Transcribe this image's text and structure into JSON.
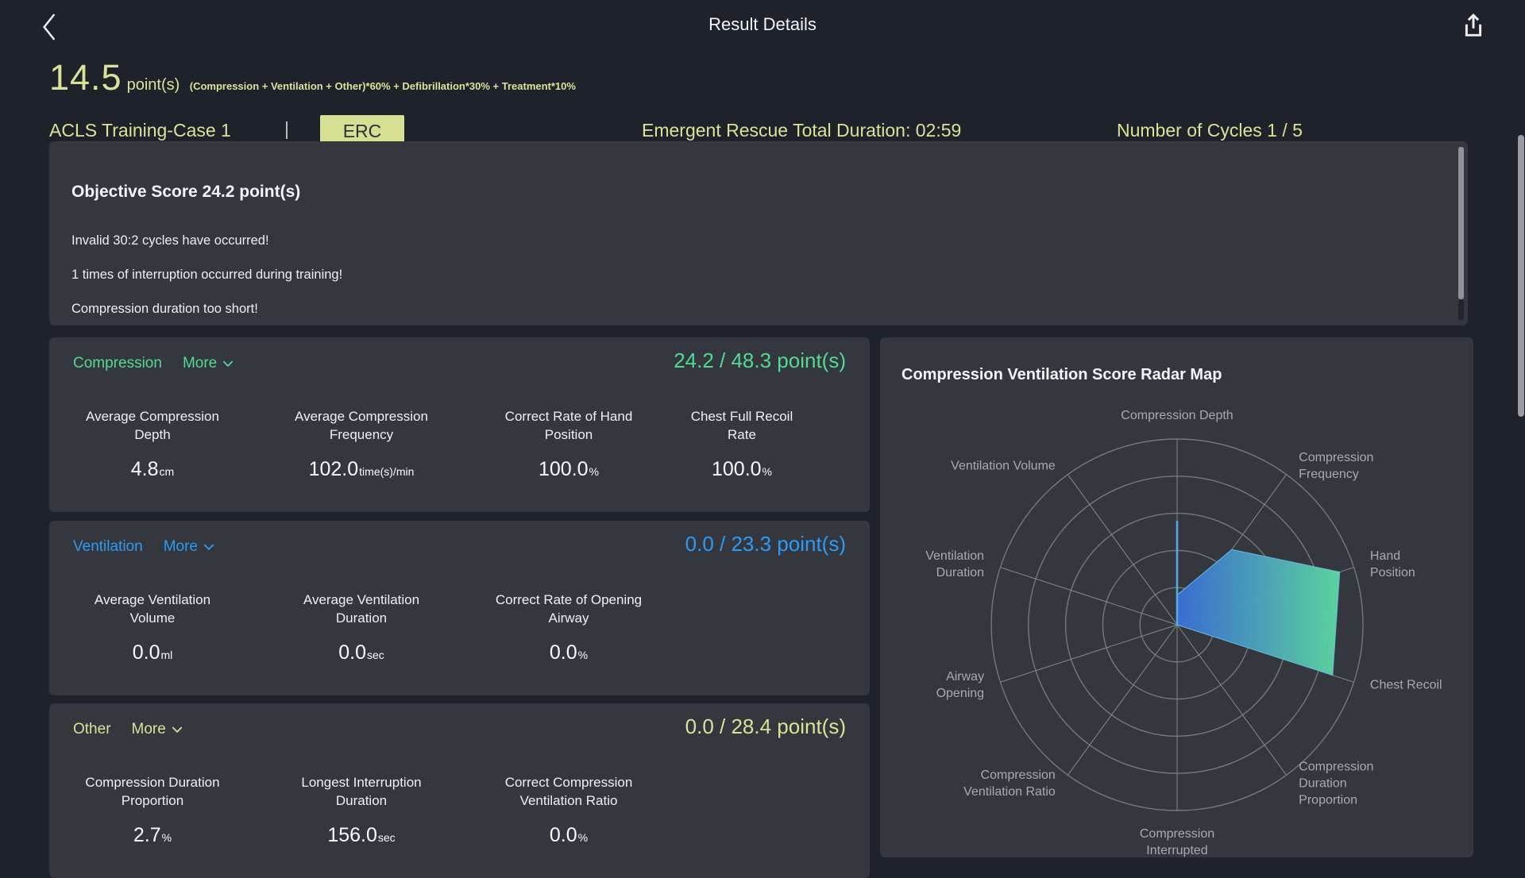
{
  "header": {
    "title": "Result Details"
  },
  "summary": {
    "score": "14.5",
    "score_unit": "point(s)",
    "formula": "(Compression + Ventilation + Other)*60% + Defibrillation*30% + Treatment*10%"
  },
  "meta": {
    "case_name": "ACLS Training-Case 1",
    "divider": "|",
    "badge": "ERC",
    "duration": "Emergent Rescue Total Duration: 02:59",
    "cycles": "Number of Cycles 1 / 5"
  },
  "objective": {
    "title": "Objective Score 24.2 point(s)",
    "messages": [
      "Invalid 30:2 cycles have occurred!",
      "1 times of interruption occurred during training!",
      "Compression duration too short!"
    ]
  },
  "sections": [
    {
      "title": "Compression",
      "more": "More",
      "score": "24.2 / 48.3 point(s)",
      "accent": "#53d993",
      "metrics": [
        {
          "label": "Average Compression Depth",
          "value": "4.8",
          "unit": "cm"
        },
        {
          "label": "Average Compression Frequency",
          "value": "102.0",
          "unit": "time(s)/min"
        },
        {
          "label": "Correct Rate of Hand Position",
          "value": "100.0",
          "unit": "%"
        },
        {
          "label": "Chest Full Recoil Rate",
          "value": "100.0",
          "unit": "%"
        }
      ]
    },
    {
      "title": "Ventilation",
      "more": "More",
      "score": "0.0 / 23.3 point(s)",
      "accent": "#2e9af3",
      "metrics": [
        {
          "label": "Average Ventilation Volume",
          "value": "0.0",
          "unit": "ml"
        },
        {
          "label": "Average Ventilation Duration",
          "value": "0.0",
          "unit": "sec"
        },
        {
          "label": "Correct Rate of Opening Airway",
          "value": "0.0",
          "unit": "%"
        }
      ]
    },
    {
      "title": "Other",
      "more": "More",
      "score": "0.0 / 28.4 point(s)",
      "accent": "#d9e297",
      "metrics": [
        {
          "label": "Compression Duration Proportion",
          "value": "2.7",
          "unit": "%"
        },
        {
          "label": "Longest Interruption Duration",
          "value": "156.0",
          "unit": "sec"
        },
        {
          "label": "Correct Compression Ventilation Ratio",
          "value": "0.0",
          "unit": "%"
        }
      ]
    }
  ],
  "radar_panel": {
    "title": "Compression Ventilation Score Radar Map"
  },
  "chart_data": {
    "type": "radar",
    "title": "Compression Ventilation Score Radar Map",
    "indicators": [
      "Compression Depth",
      "Compression Frequency",
      "Hand Position",
      "Chest Recoil",
      "Compression Duration Proportion",
      "Compression Interrupted",
      "Compression Ventilation Ratio",
      "Airway Opening",
      "Ventilation Duration",
      "Ventilation Volume"
    ],
    "max": 100,
    "rings": 5,
    "series": [
      {
        "name": "score-area",
        "type": "area",
        "values": [
          16,
          50,
          92,
          88,
          0,
          0,
          0,
          0,
          0,
          0
        ],
        "gradient": [
          "#3b6ed9",
          "#5ddaa1"
        ]
      },
      {
        "name": "compression-depth-line",
        "type": "line",
        "values": [
          56,
          0,
          0,
          0,
          0,
          0,
          0,
          0,
          0,
          0
        ],
        "color": "#54a9e0"
      }
    ],
    "grid_color": "#74777d",
    "spoke_color": "#85888e",
    "label_color": "#a7aaaf",
    "legend_position": "none"
  }
}
